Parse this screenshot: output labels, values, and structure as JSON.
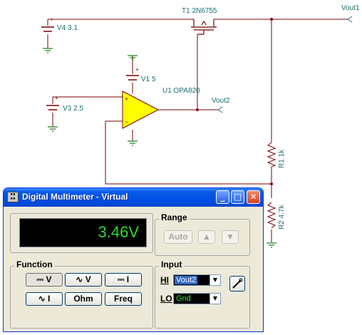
{
  "schematic": {
    "labels": {
      "v4": "V4 3.1",
      "t1": "T1 2N6755",
      "vout1": "Vout1",
      "v1": "V1 5",
      "u1": "U1 OPA820",
      "vout2": "Vout2",
      "v3": "V3 2.5",
      "r1": "R1 1k",
      "r2": "R2 4.7k"
    },
    "colors": {
      "wire": "#7a0000",
      "label": "#1a6e6e",
      "opamp_fill": "#ffff00",
      "ground": "#1a7a1a"
    }
  },
  "window": {
    "title": "Digital Multimeter - Virtual",
    "app_icon_name": "multimeter-icon",
    "buttons": {
      "minimize": "_",
      "maximize": "□",
      "close": "✕"
    }
  },
  "display": {
    "reading": "3.46V",
    "color": "#2fd82f"
  },
  "range": {
    "legend": "Range",
    "auto_label": "Auto",
    "up_icon": "triangle-up-icon",
    "down_icon": "triangle-down-icon"
  },
  "function": {
    "legend": "Function",
    "buttons": [
      "V",
      "V",
      "I",
      "I",
      "Ohm",
      "Freq"
    ]
  },
  "input": {
    "legend": "Input",
    "hi_label": "HI",
    "hi_value": "Vout2",
    "lo_label": "LO",
    "lo_value": "Gnd",
    "probe_icon": "probe-icon"
  }
}
